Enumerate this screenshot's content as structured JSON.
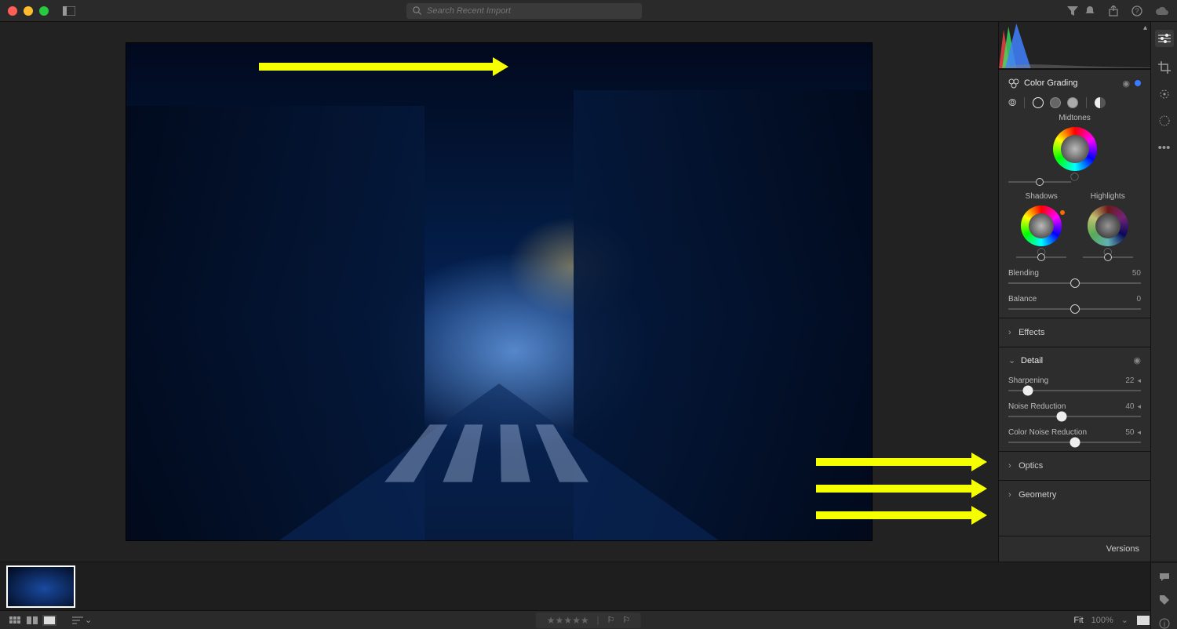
{
  "topbar": {
    "search_placeholder": "Search Recent Import"
  },
  "panels": {
    "color_grading": {
      "title": "Color Grading",
      "midtones_label": "Midtones",
      "shadows_label": "Shadows",
      "highlights_label": "Highlights",
      "blending_label": "Blending",
      "blending_value": "50",
      "balance_label": "Balance",
      "balance_value": "0"
    },
    "effects": {
      "title": "Effects"
    },
    "detail": {
      "title": "Detail",
      "sharpening_label": "Sharpening",
      "sharpening_value": "22",
      "noise_label": "Noise Reduction",
      "noise_value": "40",
      "color_noise_label": "Color Noise Reduction",
      "color_noise_value": "50"
    },
    "optics": {
      "title": "Optics"
    },
    "geometry": {
      "title": "Geometry"
    },
    "versions_label": "Versions"
  },
  "bottom": {
    "fit_label": "Fit",
    "zoom_label": "100%"
  }
}
